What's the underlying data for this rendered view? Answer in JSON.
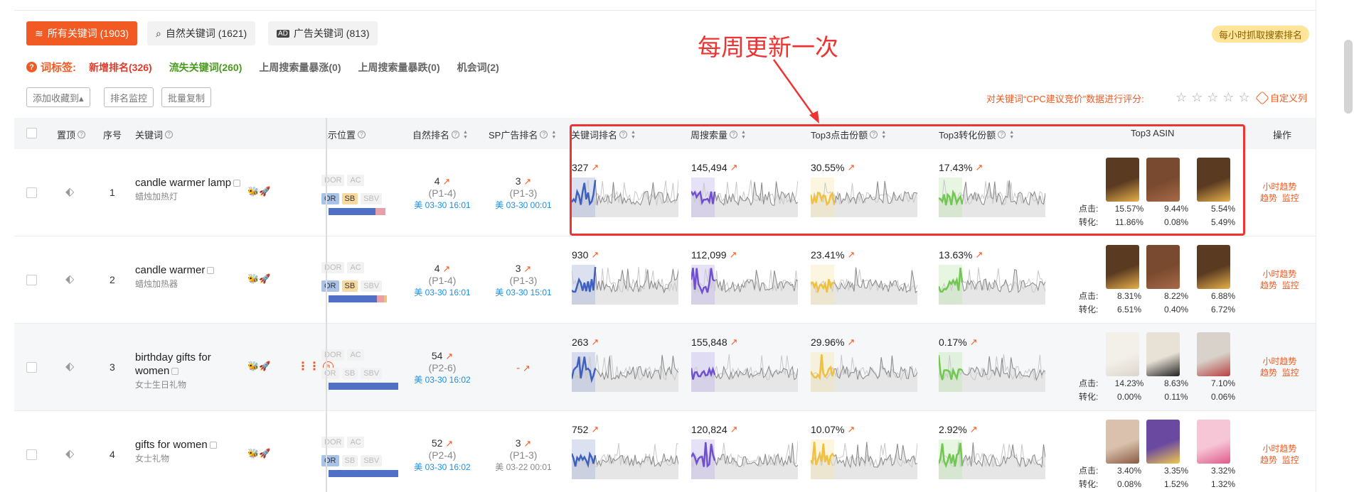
{
  "tabs": [
    {
      "label": "所有关键词 (1903)",
      "icon": "layers-icon",
      "active": true
    },
    {
      "label": "自然关键词 (1621)",
      "icon": "search-icon",
      "active": false
    },
    {
      "label": "广告关键词 (813)",
      "icon": "ad-icon",
      "active": false
    }
  ],
  "hourly_badge": "每小时抓取搜索排名",
  "tag_bar": {
    "label": "词标签:",
    "items": [
      {
        "text": "新增排名(326)",
        "color": "#e03a2a"
      },
      {
        "text": "流失关键词(260)",
        "color": "#4a9a1f"
      },
      {
        "text": "上周搜索量暴涨(0)",
        "color": "#666666"
      },
      {
        "text": "上周搜索量暴跌(0)",
        "color": "#666666"
      },
      {
        "text": "机会词(2)",
        "color": "#666666"
      }
    ]
  },
  "buttons": {
    "add_favorite": "添加收藏到▴",
    "rank_monitor": "排名监控",
    "batch_copy": "批量复制"
  },
  "cpc_note": "对关键词“CPC建议竞价”数据进行评分:",
  "custom_columns": "自定义列",
  "headers": {
    "pin": "置顶",
    "index": "序号",
    "keyword": "关键词",
    "display_pos": "展示位置",
    "natural_rank": "自然排名",
    "sp_rank": "SP广告排名",
    "kw_rank": "关键词排名",
    "weekly_search": "周搜索量",
    "top3_click": "Top3点击份额",
    "top3_conv": "Top3转化份额",
    "top3_asin": "Top3 ASIN",
    "ops": "操作"
  },
  "annotation": "每周更新一次",
  "labels": {
    "click": "点击:",
    "conv": "转化:",
    "trend_link": "小时趋势",
    "trend2": "趋势",
    "monitor": "监控",
    "pos_tags": [
      "DOR",
      "AC",
      "OR",
      "SB",
      "SBV"
    ]
  },
  "rows": [
    {
      "index": "1",
      "keyword": "candle warmer lamp",
      "keyword_cn": "蜡烛加热灯",
      "natural": {
        "rank": "4",
        "page": "(P1-4)",
        "date": "美 03-30 16:01"
      },
      "sp": {
        "rank": "3",
        "page": "(P1-3)",
        "date": "美 03-30 00:01"
      },
      "kw_rank": "327",
      "weekly_search": "145,494",
      "top3_click": "30.55%",
      "top3_conv": "17.43%",
      "asin_click": [
        "15.57%",
        "9.44%",
        "5.54%"
      ],
      "asin_conv": [
        "11.86%",
        "0.08%",
        "5.49%"
      ],
      "asin_icons": [
        "lamp-product-image",
        "wood-warmer-product-image",
        "lamp-product-image"
      ]
    },
    {
      "index": "2",
      "keyword": "candle warmer",
      "keyword_cn": "蜡烛加热器",
      "natural": {
        "rank": "4",
        "page": "(P1-4)",
        "date": "美 03-30 16:01"
      },
      "sp": {
        "rank": "3",
        "page": "(P1-3)",
        "date": "美 03-30 15:01"
      },
      "kw_rank": "930",
      "weekly_search": "112,099",
      "top3_click": "23.41%",
      "top3_conv": "13.63%",
      "asin_click": [
        "8.31%",
        "8.22%",
        "6.88%"
      ],
      "asin_conv": [
        "6.51%",
        "0.40%",
        "6.72%"
      ],
      "asin_icons": [
        "lamp-product-image",
        "wood-warmer-product-image",
        "lamp-product-image"
      ]
    },
    {
      "index": "3",
      "keyword": "birthday gifts for women",
      "keyword_cn": "女士生日礼物",
      "natural": {
        "rank": "54",
        "page": "(P2-6)",
        "date": "美 03-30 16:02"
      },
      "sp": {
        "rank": "-",
        "page": "",
        "date": ""
      },
      "kw_rank": "263",
      "weekly_search": "155,848",
      "top3_click": "29.96%",
      "top3_conv": "0.17%",
      "asin_click": [
        "14.23%",
        "8.63%",
        "7.10%"
      ],
      "asin_conv": [
        "0.00%",
        "0.11%",
        "0.06%"
      ],
      "asin_icons": [
        "socks-product-image",
        "tote-bag-product-image",
        "photo-frame-product-image"
      ]
    },
    {
      "index": "4",
      "keyword": "gifts for women",
      "keyword_cn": "女士礼物",
      "natural": {
        "rank": "52",
        "page": "(P2-4)",
        "date": "美 03-30 16:02"
      },
      "sp": {
        "rank": "3",
        "page": "(P1-3)",
        "date": "美 03-22 00:01"
      },
      "kw_rank": "752",
      "weekly_search": "120,824",
      "top3_click": "10.07%",
      "top3_conv": "2.92%",
      "asin_click": [
        "3.40%",
        "3.35%",
        "3.32%"
      ],
      "asin_conv": [
        "0.08%",
        "1.52%",
        "1.32%"
      ],
      "asin_icons": [
        "robe-product-image",
        "candle-set-product-image",
        "gift-box-product-image"
      ]
    }
  ]
}
